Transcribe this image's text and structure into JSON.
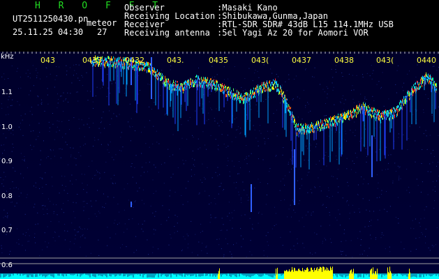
{
  "header": {
    "brand": "H R O F F T",
    "filename": "UT2511250430.pn",
    "type_label": "meteor",
    "datetime": "25.11.25 04:30",
    "count": "27",
    "fields": [
      {
        "label": "Observer",
        "value": ":Masaki Kano"
      },
      {
        "label": "Receiving Location",
        "value": ":Shibukawa,Gunma,Japan"
      },
      {
        "label": "Receiver",
        "value": ":RTL-SDR SDR# 43dB L15 114.1MHz USB"
      },
      {
        "label": "Receiving antenna",
        "value": ":5el Yagi Az 20 for Aomori VOR"
      }
    ]
  },
  "spectrogram": {
    "unit_label": "kHz",
    "y_labels": [
      "1.1",
      "1.0",
      "0.9",
      "0.8",
      "0.7",
      "0.6"
    ],
    "time_labels": [
      "043",
      "0433",
      "0432",
      "043.",
      "0435",
      "043(",
      "0437",
      "0438",
      "043(",
      "0440"
    ],
    "colors": {
      "background": "#000033",
      "trace_hot": "#ffff00",
      "trace_mid": "#00e0ff",
      "power_bar": "#00ffff",
      "meteor_power": "#ffff00",
      "grid": "#b0b0b0"
    }
  }
}
